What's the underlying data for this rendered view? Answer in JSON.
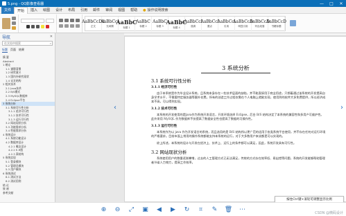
{
  "window": {
    "title": "5.png - QQ影像查看器",
    "buttons": [
      "—",
      "□",
      "✕"
    ]
  },
  "menu": {
    "tabs": [
      "文件",
      "开始",
      "插入",
      "绘图",
      "设计",
      "布局",
      "引用",
      "邮件",
      "审阅",
      "视图",
      "帮助"
    ],
    "search_label": "操作说明搜索"
  },
  "styles": {
    "items": [
      {
        "sample": "AaBbCcDd",
        "name": "正文"
      },
      {
        "sample": "AaBbCcI",
        "name": "无间隔"
      },
      {
        "sample": "AaBbC",
        "name": "标题 1"
      },
      {
        "sample": "AaBbC",
        "name": "标题 2"
      },
      {
        "sample": "AaBbC",
        "name": "标题 3"
      },
      {
        "sample": "AaBbC",
        "name": "标题 4"
      },
      {
        "sample": "AaBbCcl",
        "name": "强调"
      },
      {
        "sample": "AaBbCcl",
        "name": "要点"
      },
      {
        "sample": "AaBbCcl",
        "name": "引用"
      },
      {
        "sample": "AaBbCcD",
        "name": "明显引用"
      },
      {
        "sample": "AaBbCcD",
        "name": "列出段落"
      },
      {
        "sample": "AaBbCcD",
        "name": "书籍标题"
      }
    ]
  },
  "nav": {
    "title": "导航",
    "search_placeholder": "在文档中搜索",
    "tabs": [
      "标题",
      "页面",
      "结果"
    ],
    "items": [
      "摘 要",
      "Abstract",
      "1 绪论",
      "1.1 课题背景",
      "1.2 研究意义",
      "1.3 国内外研究现状",
      "1.4 论文结构",
      "2 相关技术",
      "2.1 Java技术",
      "2.2 B/S模式",
      "2.3 MySQL数据库",
      "2.4 Eclipse平台",
      "3 系统分析",
      "3.1 系统可行性分析",
      "3.1.1 经济可行性",
      "3.1.2 技术可行性",
      "3.1.3 运行可行性",
      "3.2 网站现状分析",
      "3.3 功能需求分析",
      "3.4 性能需求分析",
      "4 系统设计",
      "4.1 系统功能设计",
      "4.2 数据库设计",
      "4.2.1 概念设计",
      "4.2.2 E-R图",
      "4.2.3 表结构",
      "5 系统实现",
      "5.1 登录模块",
      "5.2 管理员模块",
      "5.3 用户模块",
      "6 系统测试",
      "6.1 测试方法",
      "6.2 测试用例",
      "结 论",
      "致 谢",
      "参考文献"
    ],
    "selected_index": 12
  },
  "document": {
    "chapter_title": "3  系统分析",
    "sections": [
      {
        "heading": "3.1  系统可行性分析"
      },
      {
        "heading": "3.1.1  经济可行性"
      },
      {
        "para": "由于本系统是作为毕业设计系统，且系统本身存在一些技术层面的缺陷，并不能直接用于商业用途，只想着通过该系统的开发提高自身学术水平，不需要特定服务器等额外花费。所有的创造工作过程仅需在个人电脑上就能实现，使用到的软件大多免费提供，所以经济成本不高，可以得到实现。"
      },
      {
        "heading": "3.1.2  技术可行性"
      },
      {
        "para": "本系统的开发使用的是java作为系统开发语言，开发环境选择 Eclipse，后台 B/S 结构决定了本系统的兼容性和多用户可维护性。此外采用 MySQL 作为数据库不仅提高了数据安全性也提高了数据的可操作性。"
      },
      {
        "heading": "3.1.3  运行可行性"
      },
      {
        "para": "本系统作为以 java 作为开发语言的系统，而且选用的是 B/S 结构所以更广范的适用于各类系统平台使用，并不存在任何对运行环境的严格要求。目前市面上常用的操作系统都能支持本系统的运行，对于大多数用户来说都是可以实现的。"
      },
      {
        "para": "综上所述，本系统的设计与开发在经济上、技术上、运行上的条件都可以满足，因此，系统开发具有可行性。"
      },
      {
        "heading": "3.2  网站现状分析"
      },
      {
        "para": "系统使用用户的数量逐渐攀增，过去的人工管理方式已无法满足，传统的方式存在效率低、易出错等问题，系统的开发能够帮助管理者节省人力物力，提高工作效率。"
      }
    ]
  },
  "toast": {
    "text": "按住Ctrl键+滚轮可调整显示比例"
  },
  "bottom": {
    "buttons": [
      "zoom-in",
      "zoom-out",
      "fit",
      "rotate-left",
      "prev",
      "next",
      "rotate-right",
      "crop",
      "edit",
      "delete",
      "more"
    ]
  },
  "watermark": "CSDN @微码设计"
}
